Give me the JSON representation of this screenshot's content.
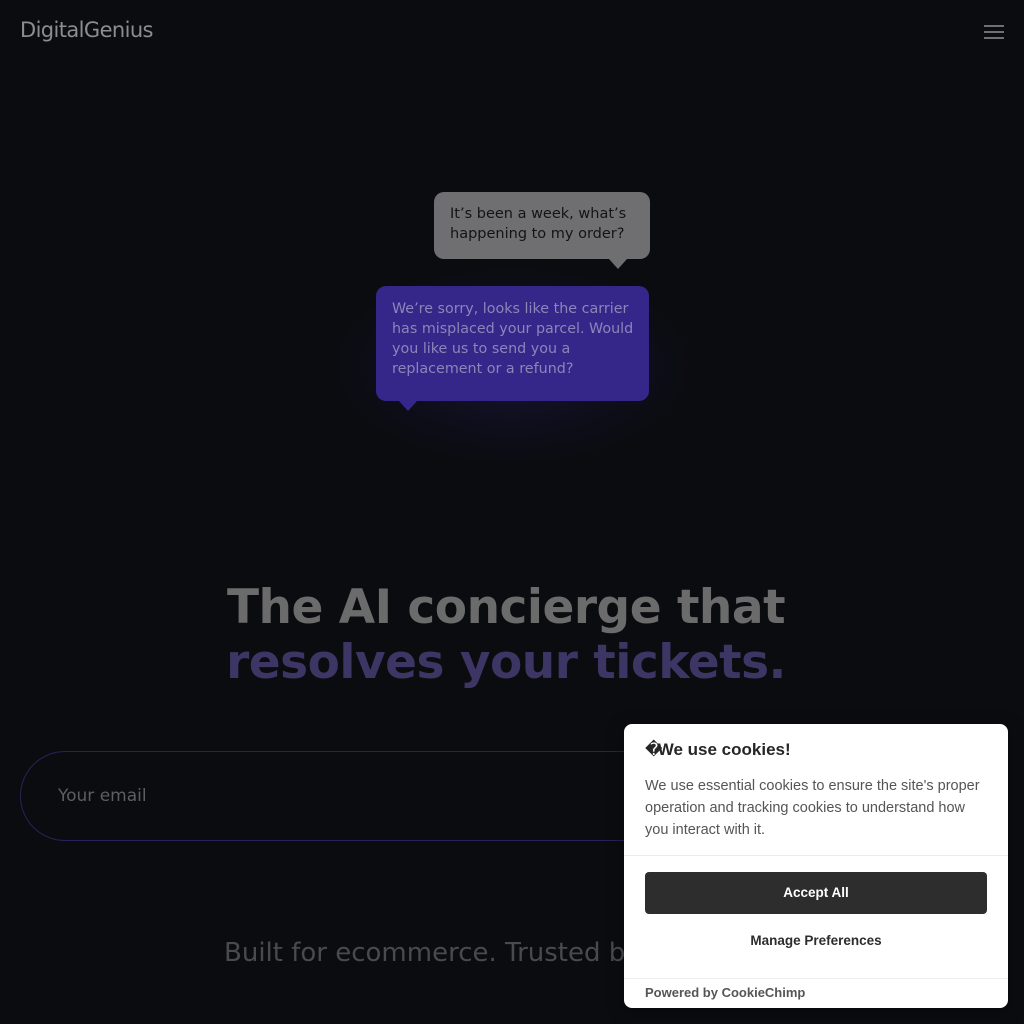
{
  "header": {
    "logo_text": "DigitalGenius",
    "menu_icon": "hamburger-menu-icon"
  },
  "chat": {
    "customer_message": "It’s been a week, what’s happening to my order?",
    "agent_message": "We’re sorry, looks like the carrier has misplaced your parcel. Would you like us to send you a replacement or a refund?"
  },
  "hero": {
    "line1": "The AI concierge that",
    "line2": "resolves your tickets."
  },
  "signup": {
    "email_placeholder": "Your email"
  },
  "tagline": "Built for ecommerce. Trusted by l",
  "cookie_banner": {
    "title": "We use cookies!",
    "icon": "cookie-icon",
    "body": "We use essential cookies to ensure the site's proper operation and tracking cookies to understand how you interact with it.",
    "accept_label": "Accept All",
    "manage_label": "Manage Preferences",
    "powered_by": "Powered by CookieChimp"
  },
  "colors": {
    "background": "#0b0c10",
    "accent": "#35268a",
    "cookie_button": "#2d2d2d"
  }
}
